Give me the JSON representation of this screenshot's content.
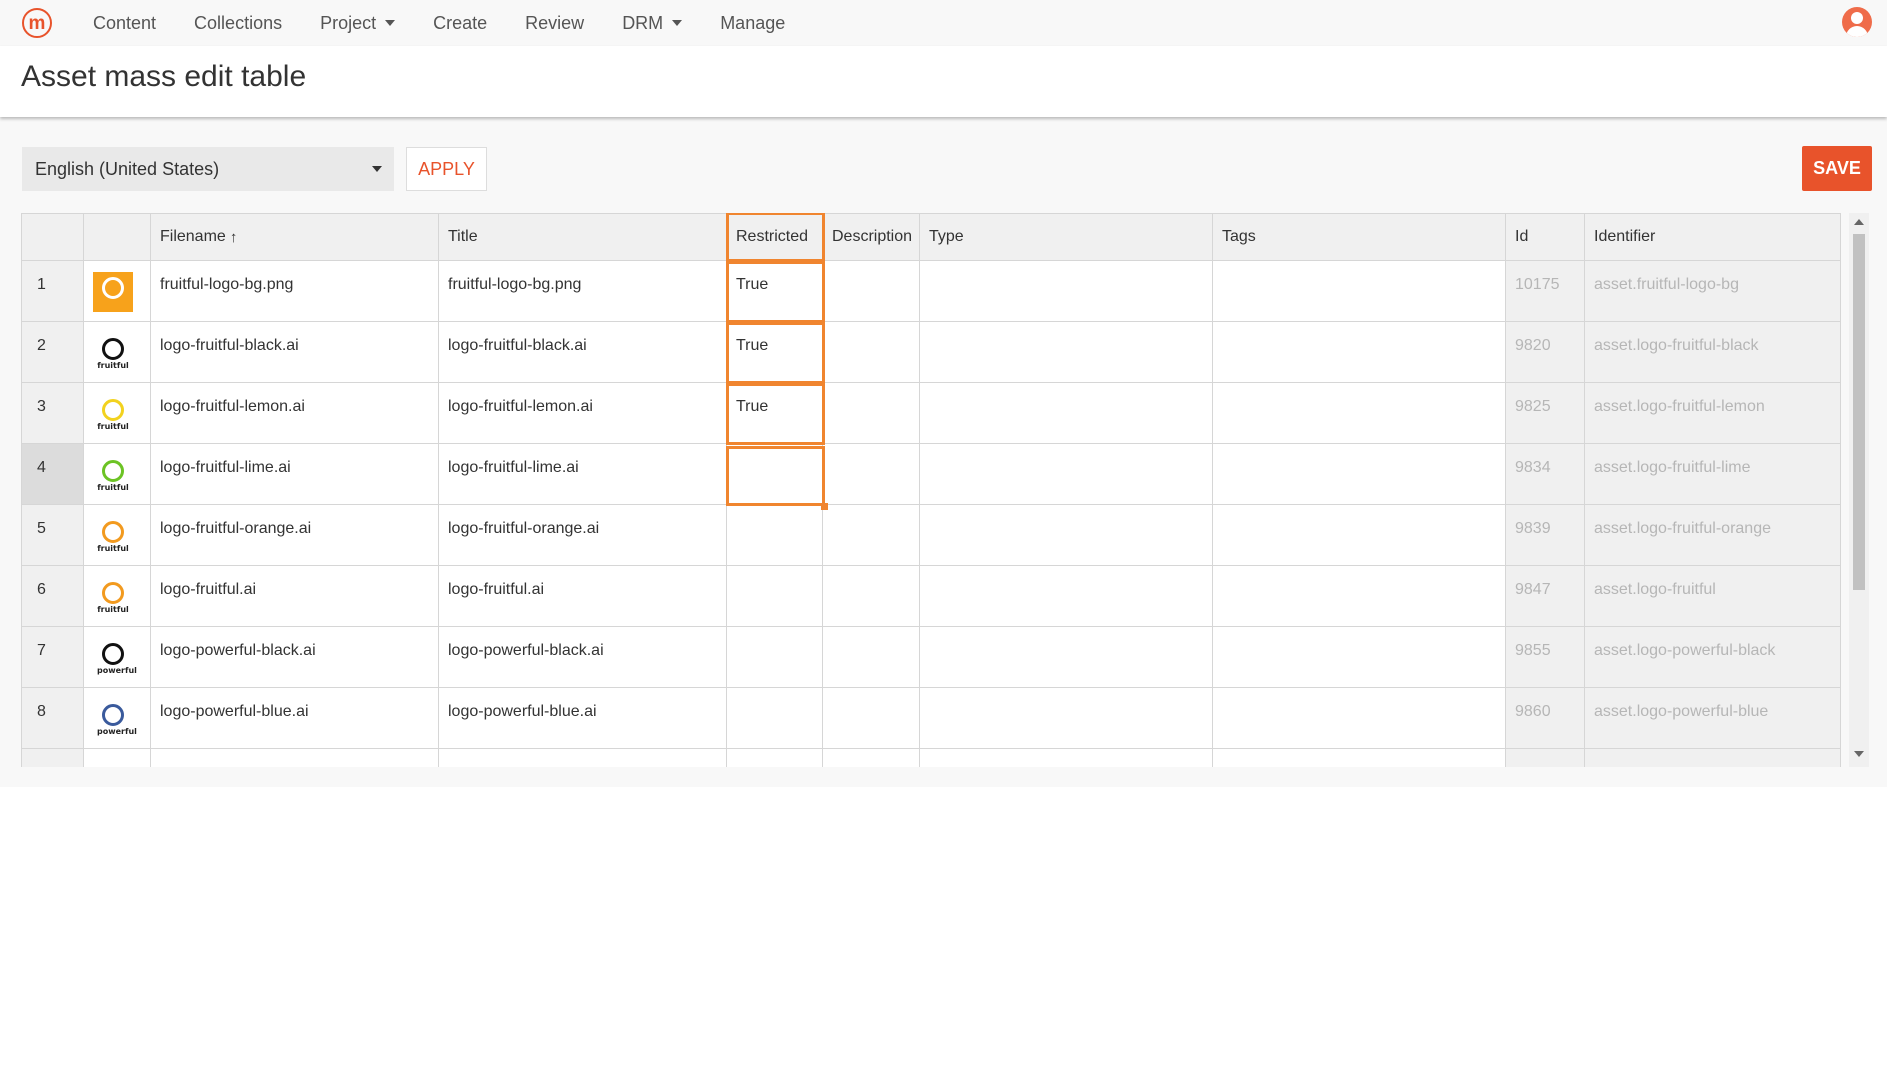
{
  "nav": {
    "logo": "m",
    "items": [
      {
        "label": "Content",
        "dropdown": false
      },
      {
        "label": "Collections",
        "dropdown": false
      },
      {
        "label": "Project",
        "dropdown": true
      },
      {
        "label": "Create",
        "dropdown": false
      },
      {
        "label": "Review",
        "dropdown": false
      },
      {
        "label": "DRM",
        "dropdown": true
      },
      {
        "label": "Manage",
        "dropdown": false
      }
    ],
    "user_icon": "user-avatar-icon"
  },
  "page_title": "Asset mass edit table",
  "toolbar": {
    "language": "English (United States)",
    "apply_label": "APPLY",
    "save_label": "SAVE"
  },
  "colors": {
    "accent": "#e8532b",
    "selection": "#f0852f"
  },
  "table": {
    "columns": [
      "",
      "",
      "Filename",
      "Title",
      "Restricted",
      "Description",
      "Type",
      "Tags",
      "Id",
      "Identifier"
    ],
    "sort_column": "Filename",
    "sort_icon": "arrow-up-icon",
    "rows": [
      {
        "num": "1",
        "thumb": "fruitful-bg",
        "filename": "fruitful-logo-bg.png",
        "title": "fruitful-logo-bg.png",
        "restricted": "True",
        "description": "",
        "type": "",
        "tags": "",
        "id": "10175",
        "identifier": "asset.fruitful-logo-bg"
      },
      {
        "num": "2",
        "thumb": "black",
        "filename": "logo-fruitful-black.ai",
        "title": "logo-fruitful-black.ai",
        "restricted": "True",
        "description": "",
        "type": "",
        "tags": "",
        "id": "9820",
        "identifier": "asset.logo-fruitful-black"
      },
      {
        "num": "3",
        "thumb": "lemon",
        "filename": "logo-fruitful-lemon.ai",
        "title": "logo-fruitful-lemon.ai",
        "restricted": "True",
        "description": "",
        "type": "",
        "tags": "",
        "id": "9825",
        "identifier": "asset.logo-fruitful-lemon"
      },
      {
        "num": "4",
        "thumb": "lime",
        "filename": "logo-fruitful-lime.ai",
        "title": "logo-fruitful-lime.ai",
        "restricted": "",
        "description": "",
        "type": "",
        "tags": "",
        "id": "9834",
        "identifier": "asset.logo-fruitful-lime"
      },
      {
        "num": "5",
        "thumb": "orange",
        "filename": "logo-fruitful-orange.ai",
        "title": "logo-fruitful-orange.ai",
        "restricted": "",
        "description": "",
        "type": "",
        "tags": "",
        "id": "9839",
        "identifier": "asset.logo-fruitful-orange"
      },
      {
        "num": "6",
        "thumb": "fruitful",
        "filename": "logo-fruitful.ai",
        "title": "logo-fruitful.ai",
        "restricted": "",
        "description": "",
        "type": "",
        "tags": "",
        "id": "9847",
        "identifier": "asset.logo-fruitful"
      },
      {
        "num": "7",
        "thumb": "powerful-black",
        "filename": "logo-powerful-black.ai",
        "title": "logo-powerful-black.ai",
        "restricted": "",
        "description": "",
        "type": "",
        "tags": "",
        "id": "9855",
        "identifier": "asset.logo-powerful-black"
      },
      {
        "num": "8",
        "thumb": "powerful-blue",
        "filename": "logo-powerful-blue.ai",
        "title": "logo-powerful-blue.ai",
        "restricted": "",
        "description": "",
        "type": "",
        "tags": "",
        "id": "9860",
        "identifier": "asset.logo-powerful-blue"
      }
    ],
    "thumb_styles": {
      "fruitful-bg": {
        "bg": "#f7a21b",
        "ring": "#ffffff",
        "text": ""
      },
      "black": {
        "bg": "",
        "ring": "#111111",
        "text": "fruitful"
      },
      "lemon": {
        "bg": "",
        "ring": "#f2d21f",
        "text": "fruitful"
      },
      "lime": {
        "bg": "",
        "ring": "#6cc324",
        "text": "fruitful"
      },
      "orange": {
        "bg": "",
        "ring": "#f29a1f",
        "text": "fruitful"
      },
      "fruitful": {
        "bg": "",
        "ring": "#f29a1f",
        "text": "fruitful"
      },
      "powerful-black": {
        "bg": "",
        "ring": "#111111",
        "text": "powerful"
      },
      "powerful-blue": {
        "bg": "",
        "ring": "#3a5a9c",
        "text": "powerful"
      }
    }
  }
}
